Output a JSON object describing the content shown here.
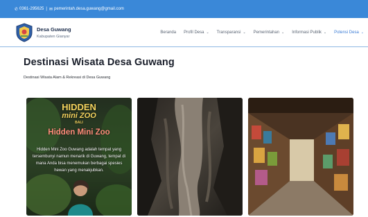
{
  "topbar": {
    "phone": "0361-295625",
    "email": "pemerintah.desa.guwang@gmail.com",
    "separator": "|"
  },
  "brand": {
    "name": "Desa Guwang",
    "subtitle": "Kabupaten Gianyar"
  },
  "menu": [
    {
      "label": "Beranda",
      "dropdown": false,
      "active": false
    },
    {
      "label": "Profil Desa",
      "dropdown": true,
      "active": false
    },
    {
      "label": "Transparansi",
      "dropdown": true,
      "active": false
    },
    {
      "label": "Pemerintahan",
      "dropdown": true,
      "active": false
    },
    {
      "label": "Informasi Publik",
      "dropdown": true,
      "active": false
    },
    {
      "label": "Potensi Desa",
      "dropdown": true,
      "active": true
    }
  ],
  "page": {
    "title": "Destinasi Wisata Desa Guwang",
    "subtitle": "Destinasi Wisata Alam & Rekreasi di Desa Guwang"
  },
  "cards": [
    {
      "sign_line1": "HIDDEN",
      "sign_line2": "mini ZOO",
      "sign_line3": "BALI",
      "title": "Hidden Mini Zoo",
      "description": "Hidden Mini Zoo Guwang adalah tempat yang tersembunyi namun menarik di Guwang, tempat di mana Anda bisa menemukan berbagai spesies hewan yang menakjubkan."
    },
    {},
    {}
  ],
  "colors": {
    "topbar_bg": "#3a88d8",
    "accent": "#3a7bd5",
    "card_title": "#ff8c7a"
  }
}
